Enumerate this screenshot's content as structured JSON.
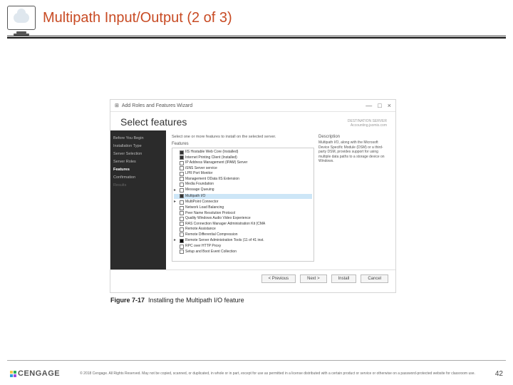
{
  "header": {
    "title": "Multipath Input/Output (2 of 3)"
  },
  "wizard": {
    "window_title": "Add Roles and Features Wizard",
    "controls": {
      "min": "—",
      "max": "□",
      "close": "×"
    },
    "heading": "Select features",
    "destination_label": "DESTINATION SERVER",
    "destination_value": "Accounting.jsomis.com",
    "sidebar": [
      {
        "label": "Before You Begin",
        "state": "normal"
      },
      {
        "label": "Installation Type",
        "state": "normal"
      },
      {
        "label": "Server Selection",
        "state": "normal"
      },
      {
        "label": "Server Roles",
        "state": "normal"
      },
      {
        "label": "Features",
        "state": "sel"
      },
      {
        "label": "Confirmation",
        "state": "normal"
      },
      {
        "label": "Results",
        "state": "dis"
      }
    ],
    "instruction": "Select one or more features to install on the selected server.",
    "features_label": "Features",
    "features": [
      {
        "cb": "chk",
        "txt": "IIS Hostable Web Core (Installed)"
      },
      {
        "cb": "chk",
        "txt": "Internet Printing Client (Installed)"
      },
      {
        "cb": "",
        "txt": "IP Address Management (IPAM) Server"
      },
      {
        "cb": "",
        "txt": "iSNS Server service"
      },
      {
        "cb": "",
        "txt": "LPR Port Monitor"
      },
      {
        "cb": "",
        "txt": "Management OData IIS Extension"
      },
      {
        "cb": "",
        "txt": "Media Foundation"
      },
      {
        "cb": "",
        "txt": "Message Queuing",
        "tri": "▸"
      },
      {
        "cb": "chk",
        "txt": "Multipath I/O",
        "hl": true
      },
      {
        "cb": "",
        "txt": "MultiPoint Connector",
        "tri": "▸"
      },
      {
        "cb": "",
        "txt": "Network Load Balancing"
      },
      {
        "cb": "",
        "txt": "Peer Name Resolution Protocol"
      },
      {
        "cb": "",
        "txt": "Quality Windows Audio Video Experience"
      },
      {
        "cb": "",
        "txt": "RAS Connection Manager Administration Kit (CMA"
      },
      {
        "cb": "",
        "txt": "Remote Assistance"
      },
      {
        "cb": "",
        "txt": "Remote Differential Compression"
      },
      {
        "cb": "fill",
        "txt": "Remote Server Administration Tools (11 of 41 inst.",
        "tri": "▸"
      },
      {
        "cb": "",
        "txt": "RPC over HTTP Proxy"
      },
      {
        "cb": "",
        "txt": "Setup and Boot Event Collection"
      }
    ],
    "description_label": "Description",
    "description_text": "Multipath I/O, along with the Microsoft Device Specific Module (DSM) or a third-party DSM, provides support for using multiple data paths to a storage device on Windows.",
    "buttons": {
      "previous": "< Previous",
      "next": "Next >",
      "install": "Install",
      "cancel": "Cancel"
    }
  },
  "figure_caption": {
    "label": "Figure 7-17",
    "text": "Installing the Multipath I/O feature"
  },
  "footer": {
    "brand": "CENGAGE",
    "copyright": "© 2018 Cengage. All Rights Reserved. May not be copied, scanned, or duplicated, in whole or in part, except for use as permitted in a license distributed with a certain product or service or otherwise on a password-protected website for classroom use.",
    "page": "42"
  }
}
